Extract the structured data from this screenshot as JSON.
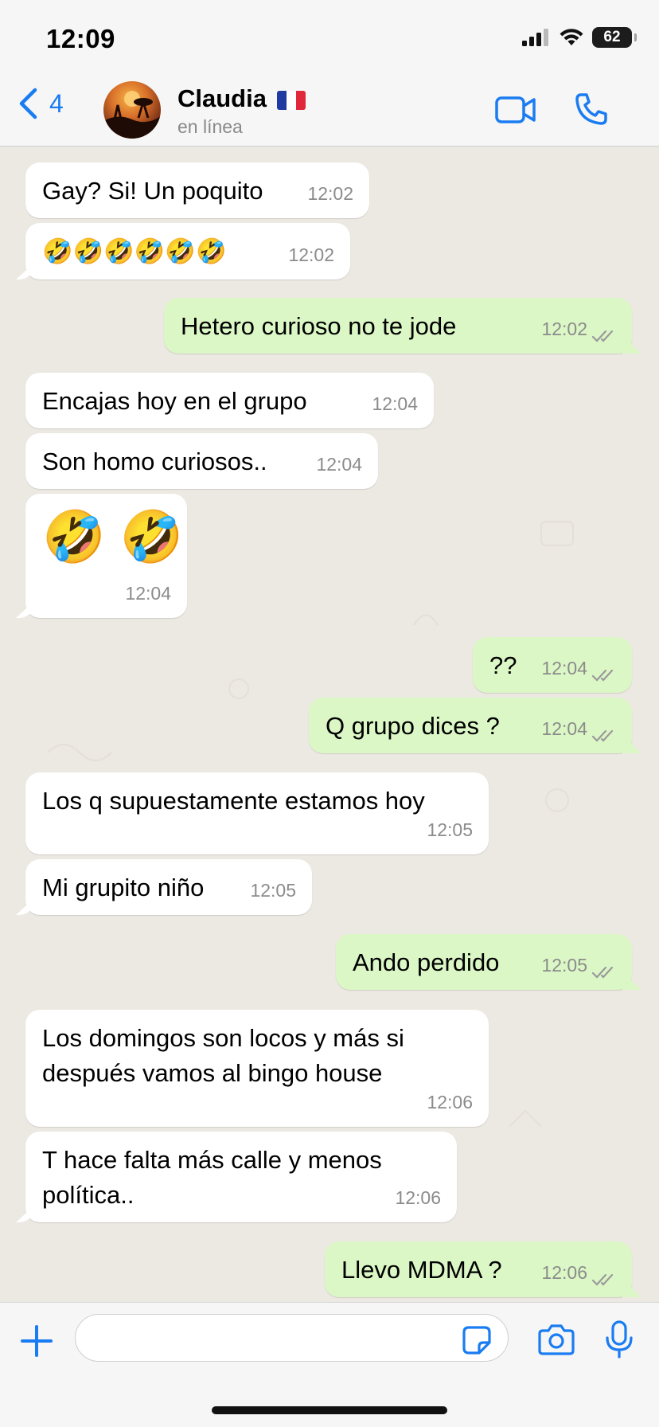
{
  "status_bar": {
    "time": "12:09",
    "battery": "62"
  },
  "header": {
    "back_count": "4",
    "contact_name": "Claudia",
    "contact_status": "en línea",
    "accent_color": "#1a7cf2"
  },
  "messages": [
    {
      "dir": "in",
      "text": "Gay? Si! Un poquito",
      "time": "12:02"
    },
    {
      "dir": "in",
      "text": "🤣🤣🤣🤣🤣🤣",
      "time": "12:02"
    },
    {
      "dir": "out",
      "text": "Hetero curioso no te jode",
      "time": "12:02",
      "status": "read"
    },
    {
      "dir": "in",
      "text": "Encajas hoy en el grupo",
      "time": "12:04"
    },
    {
      "dir": "in",
      "text": "Son homo curiosos..",
      "time": "12:04"
    },
    {
      "dir": "in",
      "text": "🤣 🤣",
      "time": "12:04"
    },
    {
      "dir": "out",
      "text": "??",
      "time": "12:04",
      "status": "read"
    },
    {
      "dir": "out",
      "text": "Q grupo dices ?",
      "time": "12:04",
      "status": "read"
    },
    {
      "dir": "in",
      "text": "Los q supuestamente estamos hoy",
      "time": "12:05"
    },
    {
      "dir": "in",
      "text": "Mi grupito niño",
      "time": "12:05"
    },
    {
      "dir": "out",
      "text": "Ando perdido",
      "time": "12:05",
      "status": "read"
    },
    {
      "dir": "in",
      "text": "Los domingos son locos y más si\ndespués vamos al bingo house",
      "time": "12:06"
    },
    {
      "dir": "in",
      "text": "T hace falta más calle y menos\npolítica..",
      "time": "12:06"
    },
    {
      "dir": "out",
      "text": "Llevo MDMA ?",
      "time": "12:06",
      "status": "read"
    }
  ],
  "composer": {
    "placeholder": ""
  },
  "colors": {
    "incoming_bubble": "#ffffff",
    "outgoing_bubble": "#dcf7c6",
    "chat_background": "#ece8e2"
  }
}
